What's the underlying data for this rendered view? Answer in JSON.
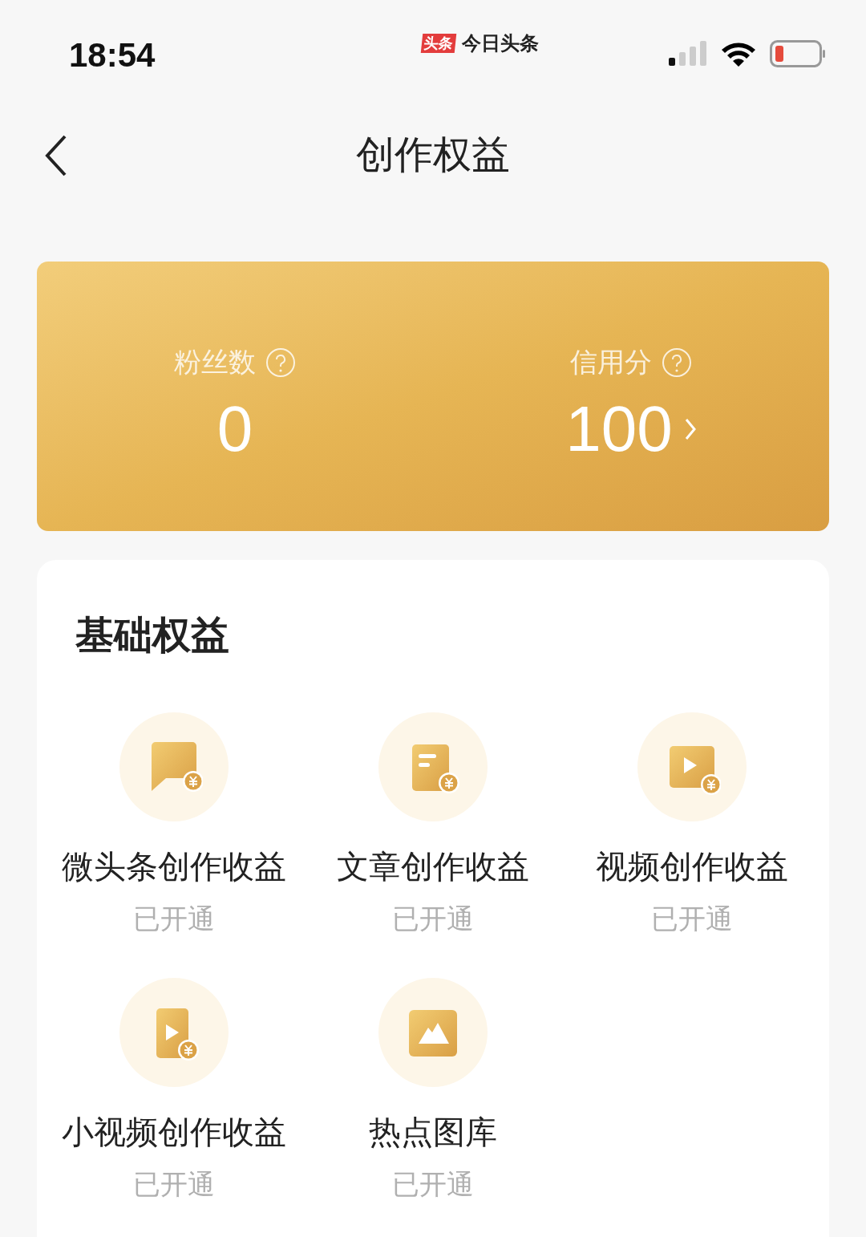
{
  "status_bar": {
    "time": "18:54",
    "app_badge": "头条",
    "app_name": "今日头条"
  },
  "nav": {
    "title": "创作权益"
  },
  "stats": [
    {
      "label": "粉丝数",
      "value": "0",
      "has_chevron": false
    },
    {
      "label": "信用分",
      "value": "100",
      "has_chevron": true
    }
  ],
  "section": {
    "title": "基础权益",
    "items": [
      {
        "kind": "chat",
        "label": "微头条创作收益",
        "status": "已开通"
      },
      {
        "kind": "article",
        "label": "文章创作收益",
        "status": "已开通"
      },
      {
        "kind": "video",
        "label": "视频创作收益",
        "status": "已开通"
      },
      {
        "kind": "short-video",
        "label": "小视频创作收益",
        "status": "已开通"
      },
      {
        "kind": "image",
        "label": "热点图库",
        "status": "已开通"
      }
    ]
  }
}
